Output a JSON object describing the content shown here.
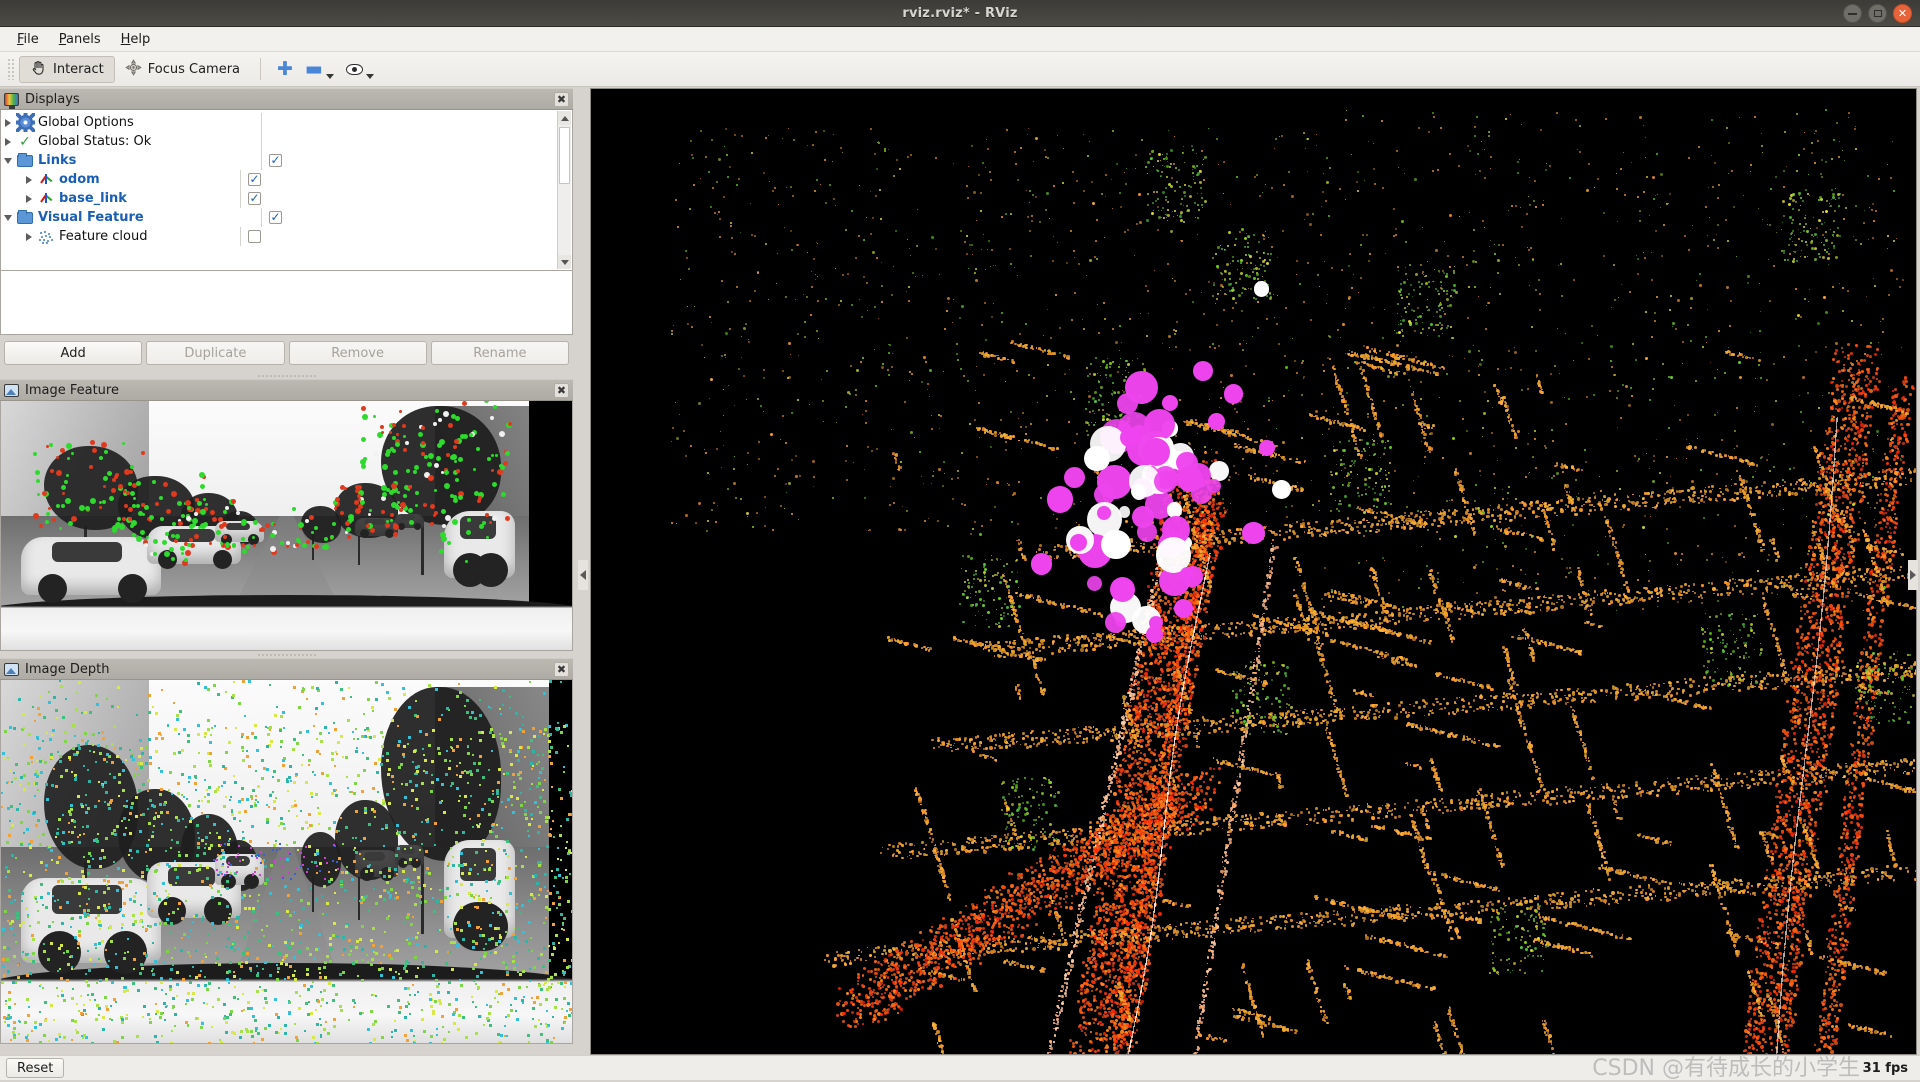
{
  "window": {
    "title": "rviz.rviz* - RViz",
    "controls": [
      {
        "name": "minimize",
        "glyph": "–"
      },
      {
        "name": "maximize",
        "glyph": "□"
      },
      {
        "name": "close",
        "glyph": "✕"
      }
    ]
  },
  "menubar": {
    "items": [
      {
        "mnemonic": "F",
        "rest": "ile"
      },
      {
        "mnemonic": "P",
        "rest": "anels"
      },
      {
        "mnemonic": "H",
        "rest": "elp"
      }
    ]
  },
  "toolbar": {
    "interact_label": "Interact",
    "interact_icon": "hand-cursor-icon",
    "focus_camera_label": "Focus Camera",
    "focus_camera_icon": "focus-camera-icon",
    "add_icon": "plus-icon",
    "remove_icon": "minus-icon",
    "visibility_icon": "eye-icon"
  },
  "displays_panel": {
    "title": "Displays",
    "title_icon": "displays-monitor-icon",
    "close_icon": "close-icon",
    "tree": [
      {
        "label": "Global Options",
        "icon": "gear-icon",
        "expander": "right",
        "indent": 0,
        "style": "plain",
        "checkbox": null
      },
      {
        "label": "Global Status: Ok",
        "icon": "check-icon",
        "expander": "right",
        "indent": 0,
        "style": "plain",
        "checkbox": null
      },
      {
        "label": "Links",
        "icon": "folder-icon",
        "expander": "down",
        "indent": 0,
        "style": "bold-blue",
        "checkbox": true
      },
      {
        "label": "odom",
        "icon": "axes-icon",
        "expander": "right",
        "indent": 1,
        "style": "bold-blue",
        "checkbox": true
      },
      {
        "label": "base_link",
        "icon": "axes-icon",
        "expander": "right",
        "indent": 1,
        "style": "bold-blue",
        "checkbox": true
      },
      {
        "label": "Visual Feature",
        "icon": "folder-icon",
        "expander": "down",
        "indent": 0,
        "style": "bold-blue",
        "checkbox": true
      },
      {
        "label": "Feature cloud",
        "icon": "pointcloud-icon",
        "expander": "right",
        "indent": 1,
        "style": "plain",
        "checkbox": false
      }
    ],
    "buttons": [
      {
        "label": "Add",
        "enabled": true
      },
      {
        "label": "Duplicate",
        "enabled": false
      },
      {
        "label": "Remove",
        "enabled": false
      },
      {
        "label": "Rename",
        "enabled": false
      }
    ],
    "description_text": ""
  },
  "image_feature_panel": {
    "title": "Image Feature",
    "title_icon": "image-icon",
    "close_icon": "close-icon"
  },
  "image_depth_panel": {
    "title": "Image Depth",
    "title_icon": "image-icon",
    "close_icon": "close-icon"
  },
  "view3d": {
    "name": "render-view",
    "background_color": "#000000"
  },
  "statusbar": {
    "reset_label": "Reset",
    "fps_label": "31 fps"
  },
  "watermark": {
    "text": "CSDN @有待成长的小学生"
  },
  "colors": {
    "accent_blue": "#1a5fb4",
    "check_green": "#2e9b3c",
    "close_orange": "#e8633a",
    "feature_magenta": "#ee44ee",
    "feature_white": "#ffffff",
    "cloud_orange": "#ff5a14",
    "cloud_red": "#ff2a06",
    "cloud_yellow": "#e8e132",
    "cloud_green": "#66d420"
  }
}
